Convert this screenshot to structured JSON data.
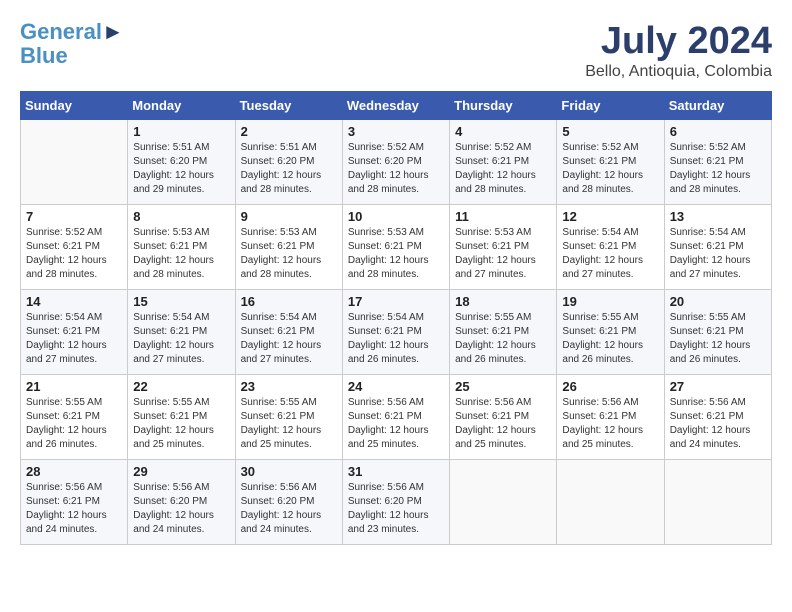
{
  "header": {
    "logo_line1": "General",
    "logo_line2": "Blue",
    "month": "July 2024",
    "location": "Bello, Antioquia, Colombia"
  },
  "days_of_week": [
    "Sunday",
    "Monday",
    "Tuesday",
    "Wednesday",
    "Thursday",
    "Friday",
    "Saturday"
  ],
  "weeks": [
    [
      {
        "day": "",
        "text": ""
      },
      {
        "day": "1",
        "text": "Sunrise: 5:51 AM\nSunset: 6:20 PM\nDaylight: 12 hours\nand 29 minutes."
      },
      {
        "day": "2",
        "text": "Sunrise: 5:51 AM\nSunset: 6:20 PM\nDaylight: 12 hours\nand 28 minutes."
      },
      {
        "day": "3",
        "text": "Sunrise: 5:52 AM\nSunset: 6:20 PM\nDaylight: 12 hours\nand 28 minutes."
      },
      {
        "day": "4",
        "text": "Sunrise: 5:52 AM\nSunset: 6:21 PM\nDaylight: 12 hours\nand 28 minutes."
      },
      {
        "day": "5",
        "text": "Sunrise: 5:52 AM\nSunset: 6:21 PM\nDaylight: 12 hours\nand 28 minutes."
      },
      {
        "day": "6",
        "text": "Sunrise: 5:52 AM\nSunset: 6:21 PM\nDaylight: 12 hours\nand 28 minutes."
      }
    ],
    [
      {
        "day": "7",
        "text": "Sunrise: 5:52 AM\nSunset: 6:21 PM\nDaylight: 12 hours\nand 28 minutes."
      },
      {
        "day": "8",
        "text": "Sunrise: 5:53 AM\nSunset: 6:21 PM\nDaylight: 12 hours\nand 28 minutes."
      },
      {
        "day": "9",
        "text": "Sunrise: 5:53 AM\nSunset: 6:21 PM\nDaylight: 12 hours\nand 28 minutes."
      },
      {
        "day": "10",
        "text": "Sunrise: 5:53 AM\nSunset: 6:21 PM\nDaylight: 12 hours\nand 28 minutes."
      },
      {
        "day": "11",
        "text": "Sunrise: 5:53 AM\nSunset: 6:21 PM\nDaylight: 12 hours\nand 27 minutes."
      },
      {
        "day": "12",
        "text": "Sunrise: 5:54 AM\nSunset: 6:21 PM\nDaylight: 12 hours\nand 27 minutes."
      },
      {
        "day": "13",
        "text": "Sunrise: 5:54 AM\nSunset: 6:21 PM\nDaylight: 12 hours\nand 27 minutes."
      }
    ],
    [
      {
        "day": "14",
        "text": "Sunrise: 5:54 AM\nSunset: 6:21 PM\nDaylight: 12 hours\nand 27 minutes."
      },
      {
        "day": "15",
        "text": "Sunrise: 5:54 AM\nSunset: 6:21 PM\nDaylight: 12 hours\nand 27 minutes."
      },
      {
        "day": "16",
        "text": "Sunrise: 5:54 AM\nSunset: 6:21 PM\nDaylight: 12 hours\nand 27 minutes."
      },
      {
        "day": "17",
        "text": "Sunrise: 5:54 AM\nSunset: 6:21 PM\nDaylight: 12 hours\nand 26 minutes."
      },
      {
        "day": "18",
        "text": "Sunrise: 5:55 AM\nSunset: 6:21 PM\nDaylight: 12 hours\nand 26 minutes."
      },
      {
        "day": "19",
        "text": "Sunrise: 5:55 AM\nSunset: 6:21 PM\nDaylight: 12 hours\nand 26 minutes."
      },
      {
        "day": "20",
        "text": "Sunrise: 5:55 AM\nSunset: 6:21 PM\nDaylight: 12 hours\nand 26 minutes."
      }
    ],
    [
      {
        "day": "21",
        "text": "Sunrise: 5:55 AM\nSunset: 6:21 PM\nDaylight: 12 hours\nand 26 minutes."
      },
      {
        "day": "22",
        "text": "Sunrise: 5:55 AM\nSunset: 6:21 PM\nDaylight: 12 hours\nand 25 minutes."
      },
      {
        "day": "23",
        "text": "Sunrise: 5:55 AM\nSunset: 6:21 PM\nDaylight: 12 hours\nand 25 minutes."
      },
      {
        "day": "24",
        "text": "Sunrise: 5:56 AM\nSunset: 6:21 PM\nDaylight: 12 hours\nand 25 minutes."
      },
      {
        "day": "25",
        "text": "Sunrise: 5:56 AM\nSunset: 6:21 PM\nDaylight: 12 hours\nand 25 minutes."
      },
      {
        "day": "26",
        "text": "Sunrise: 5:56 AM\nSunset: 6:21 PM\nDaylight: 12 hours\nand 25 minutes."
      },
      {
        "day": "27",
        "text": "Sunrise: 5:56 AM\nSunset: 6:21 PM\nDaylight: 12 hours\nand 24 minutes."
      }
    ],
    [
      {
        "day": "28",
        "text": "Sunrise: 5:56 AM\nSunset: 6:21 PM\nDaylight: 12 hours\nand 24 minutes."
      },
      {
        "day": "29",
        "text": "Sunrise: 5:56 AM\nSunset: 6:20 PM\nDaylight: 12 hours\nand 24 minutes."
      },
      {
        "day": "30",
        "text": "Sunrise: 5:56 AM\nSunset: 6:20 PM\nDaylight: 12 hours\nand 24 minutes."
      },
      {
        "day": "31",
        "text": "Sunrise: 5:56 AM\nSunset: 6:20 PM\nDaylight: 12 hours\nand 23 minutes."
      },
      {
        "day": "",
        "text": ""
      },
      {
        "day": "",
        "text": ""
      },
      {
        "day": "",
        "text": ""
      }
    ]
  ]
}
